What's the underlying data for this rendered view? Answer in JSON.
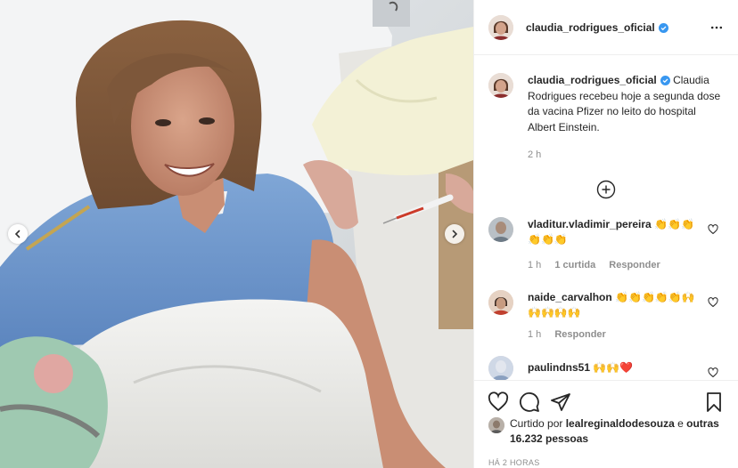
{
  "post": {
    "username": "claudia_rodrigues_oficial",
    "caption": "Claudia Rodrigues recebeu hoje a segunda dose da vacina Pfizer no leito do hospital Albert Einstein.",
    "caption_time": "2 h",
    "photo_description_icon": "photo-of-woman-receiving-vaccine"
  },
  "comments": [
    {
      "username": "vladitur.vladimir_pereira",
      "text": "👏👏👏👏👏👏",
      "time": "1 h",
      "likes": "1 curtida",
      "reply": "Responder"
    },
    {
      "username": "naide_carvalhon",
      "text": "👏👏👏👏👏🙌🙌🙌🙌🙌",
      "time": "1 h",
      "reply": "Responder"
    },
    {
      "username": "paulindns51",
      "text": "🙌🙌❤️"
    }
  ],
  "likes": {
    "prefix": "Curtido por",
    "user": "lealreginaldodesouza",
    "connector": "e",
    "others": "outras 16.232 pessoas"
  },
  "timestamp": "HÁ 2 HORAS",
  "icons": [
    "verified-badge-icon",
    "more-options-icon",
    "load-more-comments-icon",
    "heart-icon",
    "comment-icon",
    "share-icon",
    "bookmark-icon",
    "chevron-left-icon",
    "chevron-right-icon"
  ],
  "colors": {
    "verified": "#3897f0",
    "text": "#262626",
    "muted": "#8e8e8e",
    "border": "#efefef",
    "heart_red": "#ed4956"
  }
}
